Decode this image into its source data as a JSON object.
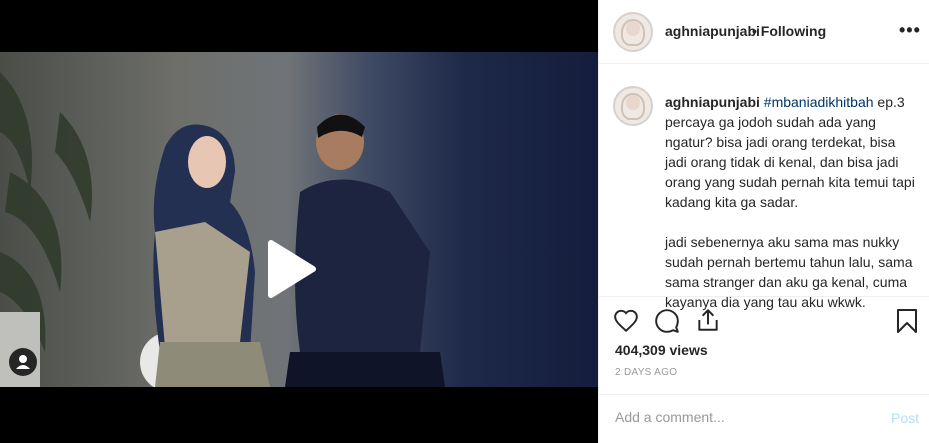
{
  "post": {
    "username": "aghniapunjabi",
    "separator": "•",
    "follow_status": "Following",
    "more_label": "•••"
  },
  "caption": {
    "username": "aghniapunjabi",
    "hashtag": "#mbaniadikhitbah",
    "lines": [
      "ep.3 percaya ga jodoh sudah ada yang ngatur? bisa jadi orang terdekat, bisa jadi orang tidak di kenal, dan bisa jadi orang yang sudah pernah kita temui tapi kadang kita ga sadar.",
      "jadi sebenernya aku sama mas nukky sudah pernah bertemu tahun lalu, sama sama stranger dan aku ga kenal, cuma kayanya dia yang tau aku wkwk."
    ]
  },
  "actions": {
    "like_icon": "heart-icon",
    "comment_icon": "comment-icon",
    "share_icon": "share-icon",
    "save_icon": "bookmark-icon"
  },
  "stats": {
    "views": "404,309 views",
    "time_ago": "2 DAYS AGO"
  },
  "comment": {
    "placeholder": "Add a comment...",
    "post_label": "Post"
  },
  "video": {
    "play_icon": "play-icon",
    "profile_icon": "user-tag-icon"
  }
}
